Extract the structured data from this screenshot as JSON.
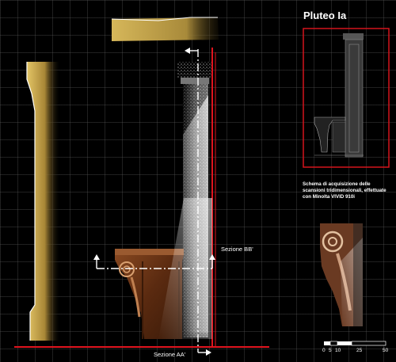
{
  "title": "Pluteo Ia",
  "caption": "Schema di acquisizione delle scansioni tridimensionali, effettuate con Minolta VIVID 910i",
  "section_bb": "Sezione BB'",
  "section_aa": "Sezione AA'",
  "scale": {
    "ticks": [
      "0",
      "5",
      "10",
      "25",
      "50"
    ]
  },
  "colors": {
    "profile_gold": "#c9a84a",
    "section_red": "#e0141e",
    "frame_red": "#d4141c",
    "wood": "#6b3416",
    "grid": "#3a3a3a"
  }
}
